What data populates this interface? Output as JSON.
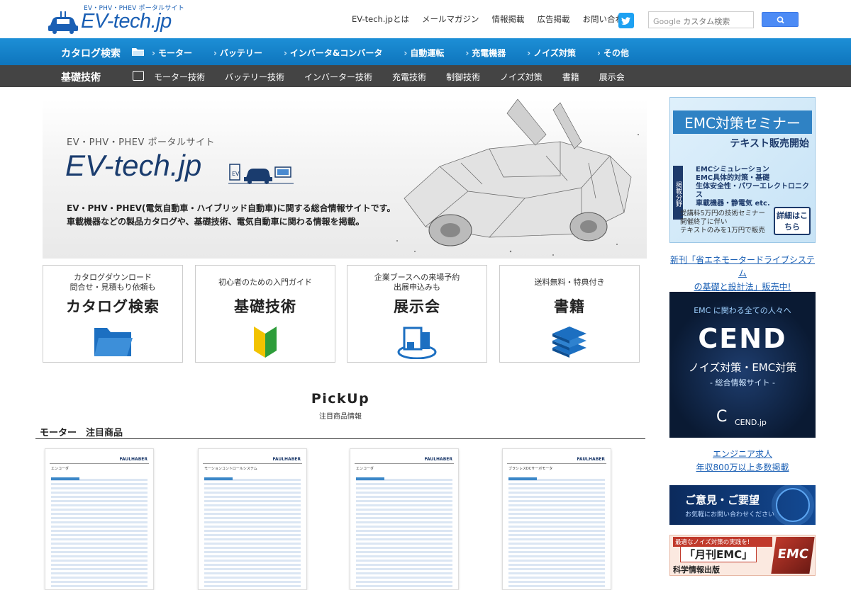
{
  "header": {
    "logo_tagline": "EV・PHV・PHEV ポータルサイト",
    "logo_text": "EV-tech.jp",
    "nav": [
      "EV-tech.jpとは",
      "メールマガジン",
      "情報掲載",
      "広告掲載",
      "お問い合わせ"
    ],
    "search_placeholder": "カスタム検索",
    "search_brand": "Google"
  },
  "catalog_nav": {
    "title": "カタログ検索",
    "items": [
      "モーター",
      "バッテリー",
      "インバータ&コンバータ",
      "自動運転",
      "充電機器",
      "ノイズ対策",
      "その他"
    ]
  },
  "basics_nav": {
    "title": "基礎技術",
    "items": [
      "モーター技術",
      "バッテリー技術",
      "インバーター技術",
      "充電技術",
      "制御技術",
      "ノイズ対策",
      "書籍",
      "展示会"
    ]
  },
  "hero": {
    "tagline": "EV・PHV・PHEV ポータルサイト",
    "logo": "EV-tech.jp",
    "desc1": "EV・PHV・PHEV(電気自動車・ハイブリッド自動車)に関する総合情報サイトです。",
    "desc2": "車載機器などの製品カタログや、基礎技術、電気自動車に関わる情報を掲載。"
  },
  "cards": [
    {
      "sub1": "カタログダウンロード",
      "sub2": "問合せ・見積もり依頼も",
      "main": "カタログ検索",
      "icon": "folder-icon"
    },
    {
      "sub1": "初心者のための入門ガイド",
      "sub2": "",
      "main": "基礎技術",
      "icon": "beginner-mark-icon"
    },
    {
      "sub1": "企業ブースへの来場予約",
      "sub2": "出展申込みも",
      "main": "展示会",
      "icon": "booth-icon"
    },
    {
      "sub1": "送料無料・特典付き",
      "sub2": "",
      "main": "書籍",
      "icon": "books-icon"
    }
  ],
  "pickup": {
    "title": "PickUp",
    "subtitle": "注目商品情報",
    "section": "モーター　注目商品",
    "products": [
      {
        "brand": "FAULHABER",
        "title": "エンコーダ"
      },
      {
        "brand": "FAULHABER",
        "title": "モーションコントロールシステム"
      },
      {
        "brand": "FAULHABER",
        "title": "エンコーダ"
      },
      {
        "brand": "FAULHABER",
        "title": "ブラシレスDCサーボモータ"
      }
    ]
  },
  "sidebar": {
    "emc": {
      "title": "EMC対策セミナー",
      "subtitle": "テキスト販売開始",
      "label": "掲載分野",
      "topics": [
        "EMCシミュレーション",
        "EMC具体的対策・基礎",
        "生体安全性・パワーエレクトロニクス",
        "車載機器・静電気 etc."
      ],
      "note1": "受講料5万円の技術セミナー",
      "note2": "開催終了に伴い",
      "note3": "テキストのみを1万円で販売",
      "more": "詳細はこちら"
    },
    "link1a": "新刊「省エネモータードライブシステム",
    "link1b": "の基礎と設計法」販売中!",
    "cend": {
      "top": "EMC に関わる全ての人々へ",
      "name": "CEND",
      "line1": "ノイズ対策・EMC対策",
      "line2": "- 総合情報サイト -",
      "domain": "CEND.jp"
    },
    "link2a": "エンジニア求人",
    "link2b": "年収800万以上多数掲載",
    "opinion": {
      "title": "ご意見・ご要望",
      "sub": "お気軽にお問い合わせください"
    },
    "monthly": {
      "top": "最適なノイズ対策の実践を!",
      "title": "「月刊EMC」",
      "publisher": "科学情報出版",
      "mark": "EMC"
    }
  },
  "colors": {
    "brand_blue": "#1a5fb4",
    "catnav": "#0e75bd",
    "basenav": "#444444",
    "twitter": "#1da1f2"
  }
}
